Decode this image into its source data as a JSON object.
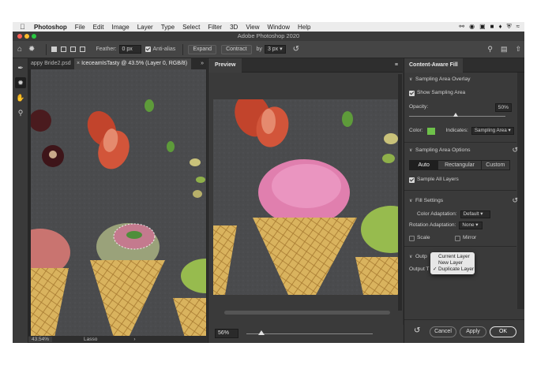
{
  "menubar": {
    "app_name": "Photoshop",
    "items": [
      "File",
      "Edit",
      "Image",
      "Layer",
      "Type",
      "Select",
      "Filter",
      "3D",
      "View",
      "Window",
      "Help"
    ]
  },
  "window": {
    "title": "Adobe Photoshop 2020",
    "traffic_lights": [
      "#ff5f57",
      "#febc2e",
      "#28c840"
    ]
  },
  "options_bar": {
    "feather_label": "Feather:",
    "feather_value": "0 px",
    "antialias_label": "Anti-alias",
    "expand_label": "Expand",
    "contract_label": "Contract",
    "by_label": "by",
    "by_value": "3 px"
  },
  "doc_tabs": [
    {
      "label": "appy Bride2.psd"
    },
    {
      "label": "IceceamIsTasty @ 43.5% (Layer 0, RGB/8)"
    }
  ],
  "doc_status": {
    "zoom": "43.54%",
    "tool": "Lasso"
  },
  "preview": {
    "tab": "Preview",
    "zoom": "56%",
    "zoom_slider_fraction": 0.12
  },
  "panel": {
    "tab": "Content-Aware Fill",
    "sampling_overlay": {
      "title": "Sampling Area Overlay",
      "show_label": "Show Sampling Area",
      "opacity_label": "Opacity:",
      "opacity_value": "50%",
      "color_label": "Color:",
      "indicates_label": "Indicates:",
      "indicates_value": "Sampling Area",
      "color_swatch": "#6ec14a"
    },
    "sampling_options": {
      "title": "Sampling Area Options",
      "modes": [
        "Auto",
        "Rectangular",
        "Custom"
      ],
      "active_mode": "Auto",
      "sample_all_label": "Sample All Layers"
    },
    "fill_settings": {
      "title": "Fill Settings",
      "color_adapt_label": "Color Adaptation:",
      "color_adapt_value": "Default",
      "rotation_label": "Rotation Adaptation:",
      "rotation_value": "None",
      "scale_label": "Scale",
      "mirror_label": "Mirror"
    },
    "output": {
      "title_partial": "Outp",
      "output_to_partial": "Output T"
    },
    "dropdown": [
      "Current Layer",
      "New Layer",
      "Duplicate Layer"
    ],
    "dropdown_selected": "Duplicate Layer",
    "buttons": {
      "cancel": "Cancel",
      "apply": "Apply",
      "ok": "OK"
    }
  }
}
